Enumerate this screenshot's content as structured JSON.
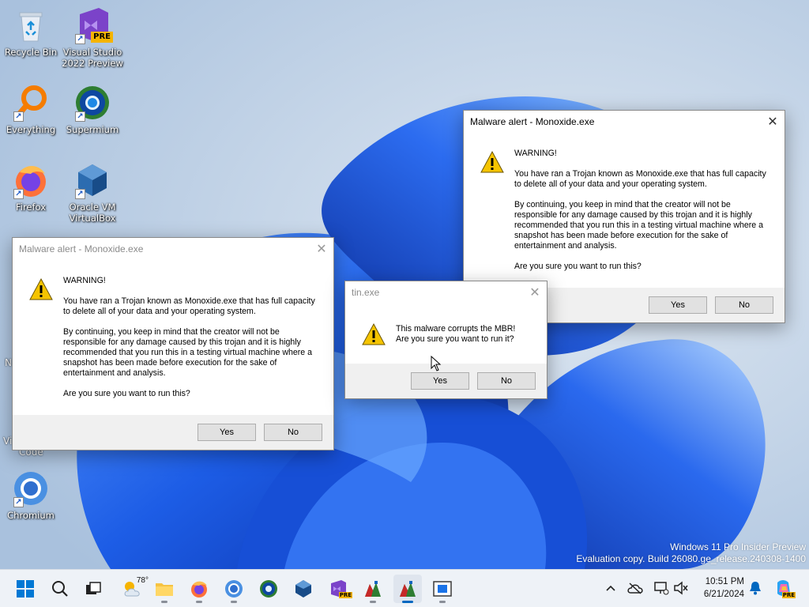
{
  "desktop": {
    "icons": [
      {
        "label": "Recycle Bin",
        "icon": "recycle-bin-icon"
      },
      {
        "label": "Visual Studio 2022 Preview",
        "icon": "visual-studio-preview-icon",
        "badge": "PRE"
      },
      {
        "label": "Everything",
        "icon": "everything-search-icon"
      },
      {
        "label": "Supermium",
        "icon": "supermium-icon"
      },
      {
        "label": "Firefox",
        "icon": "firefox-icon"
      },
      {
        "label": "Oracle VM VirtualBox",
        "icon": "virtualbox-icon"
      },
      {
        "label": "Chromium",
        "icon": "chromium-icon"
      }
    ],
    "partial_labels": [
      "N",
      "Vi",
      "Code"
    ]
  },
  "dialogs": {
    "right": {
      "title": "Malware alert - Monoxide.exe",
      "heading": "WARNING!",
      "para1": "You have ran a Trojan known as Monoxide.exe that has full capacity to delete all of your data and your operating system.",
      "para2": "By continuing, you keep in mind that the creator will not be responsible for any damage caused by this trojan and it is highly recommended that you run this in a testing virtual machine where a snapshot has been made before execution for the sake of entertainment and analysis.",
      "question": "Are you sure you want to run this?",
      "yes": "Yes",
      "no": "No"
    },
    "left": {
      "title": "Malware alert - Monoxide.exe",
      "heading": "WARNING!",
      "para1": "You have ran a Trojan known as Monoxide.exe that has full capacity to delete all of your data and your operating system.",
      "para2": "By continuing, you keep in mind that the creator will not be responsible for any damage caused by this trojan and it is highly recommended that you run this in a testing virtual machine where a snapshot has been made before execution for the sake of entertainment and analysis.",
      "question": "Are you sure you want to run this?",
      "yes": "Yes",
      "no": "No"
    },
    "middle": {
      "title": "tin.exe",
      "line1": "This malware corrupts the MBR!",
      "line2": "Are you sure you want to run it?",
      "yes": "Yes",
      "no": "No"
    }
  },
  "watermark": {
    "line1": "Windows 11 Pro Insider Preview",
    "line2": "Evaluation copy. Build 26080.ge_release.240308-1400"
  },
  "taskbar": {
    "weather_temp": "78°",
    "items": [
      "start-icon",
      "search-icon",
      "task-view-icon",
      "weather-widget",
      "file-explorer-icon",
      "firefox-icon",
      "chromium-icon",
      "supermium-icon",
      "virtualbox-icon",
      "visual-studio-icon",
      "app-icon-1",
      "app-icon-2",
      "app-icon-3"
    ],
    "vs_badge": "PRE",
    "copilot_badge": "PRE",
    "clock": {
      "time": "10:51 PM",
      "date": "6/21/2024"
    }
  },
  "colors": {
    "accent": "#0078d7",
    "wallpaper_blue": "#1f5fe0",
    "wallpaper_bg": "#c4d5e8",
    "taskbar_bg": "#eef2f7"
  }
}
